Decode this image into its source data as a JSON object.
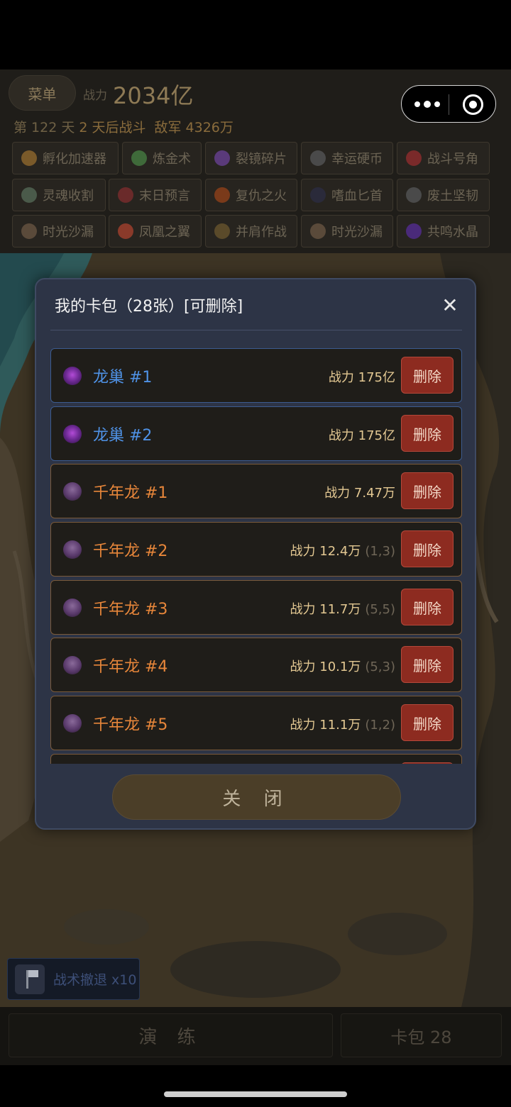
{
  "header": {
    "menu_label": "菜单",
    "power_label": "战力",
    "power_value": "2034亿",
    "day_prefix": "第 122 天",
    "battle_in": "2 天后战斗",
    "enemy": "敌军 4326万"
  },
  "cards": [
    {
      "label": "孵化加速器",
      "color": "#7a5a2a"
    },
    {
      "label": "炼金术",
      "color": "#3f6a3a"
    },
    {
      "label": "裂镜碎片",
      "color": "#5a3a7a"
    },
    {
      "label": "幸运硬币",
      "color": "#4a4a4a"
    },
    {
      "label": "战斗号角",
      "color": "#7a2a2a"
    },
    {
      "label": "灵魂收割",
      "color": "#4a5a4a"
    },
    {
      "label": "末日预言",
      "color": "#6a2a2a"
    },
    {
      "label": "复仇之火",
      "color": "#7a3a1a"
    },
    {
      "label": "嗜血匕首",
      "color": "#2a2a3a"
    },
    {
      "label": "废土坚韧",
      "color": "#4a4a4a"
    },
    {
      "label": "时光沙漏",
      "color": "#5a4a3a"
    },
    {
      "label": "凤凰之翼",
      "color": "#8a3a2a"
    },
    {
      "label": "并肩作战",
      "color": "#5a4a2a"
    },
    {
      "label": "时光沙漏",
      "color": "#5a4a3a"
    },
    {
      "label": "共鸣水晶",
      "color": "#4a2a7a"
    }
  ],
  "modal": {
    "title": "我的卡包（28张）[可删除]",
    "close_icon": "close-icon",
    "close_button": "关 闭",
    "items": [
      {
        "name": "龙巢 #1",
        "power": "战力 175亿",
        "pos": "",
        "type": "blue",
        "icon": "nest-icon",
        "delete": "删除"
      },
      {
        "name": "龙巢 #2",
        "power": "战力 175亿",
        "pos": "",
        "type": "blue",
        "icon": "nest-icon",
        "delete": "删除"
      },
      {
        "name": "千年龙 #1",
        "power": "战力 7.47万",
        "pos": "",
        "type": "orange",
        "icon": "dragon-icon",
        "delete": "删除"
      },
      {
        "name": "千年龙 #2",
        "power": "战力 12.4万",
        "pos": "(1,3)",
        "type": "orange",
        "icon": "dragon-icon",
        "delete": "删除"
      },
      {
        "name": "千年龙 #3",
        "power": "战力 11.7万",
        "pos": "(5,5)",
        "type": "orange",
        "icon": "dragon-icon",
        "delete": "删除"
      },
      {
        "name": "千年龙 #4",
        "power": "战力 10.1万",
        "pos": "(5,3)",
        "type": "orange",
        "icon": "dragon-icon",
        "delete": "删除"
      },
      {
        "name": "千年龙 #5",
        "power": "战力 11.1万",
        "pos": "(1,2)",
        "type": "orange",
        "icon": "dragon-icon",
        "delete": "删除"
      }
    ]
  },
  "retreat": {
    "label": "战术撤退 x10",
    "icon": "flag-icon"
  },
  "bottom": {
    "drill_label": "演 练",
    "pack_label": "卡包 28"
  }
}
